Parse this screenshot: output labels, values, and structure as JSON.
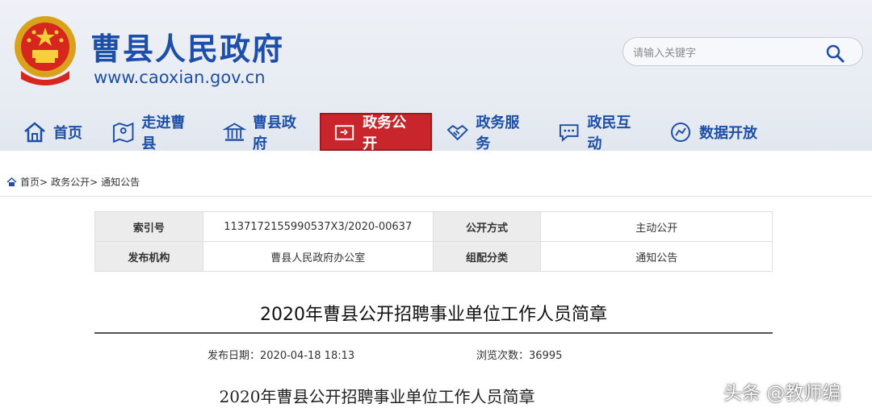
{
  "header": {
    "site_title": "曹县人民政府",
    "site_url": "www.caoxian.gov.cn",
    "search_placeholder": "请输入关键字"
  },
  "nav": [
    {
      "label": "首页",
      "icon": "home-icon"
    },
    {
      "label": "走进曹县",
      "icon": "map-icon"
    },
    {
      "label": "曹县政府",
      "icon": "government-building-icon"
    },
    {
      "label": "政务公开",
      "icon": "document-icon",
      "active": true
    },
    {
      "label": "政务服务",
      "icon": "handshake-icon"
    },
    {
      "label": "政民互动",
      "icon": "chat-icon"
    },
    {
      "label": "数据开放",
      "icon": "data-icon"
    }
  ],
  "breadcrumb": [
    "首页>",
    "政务公开>",
    "通知公告"
  ],
  "meta": {
    "index_label": "索引号",
    "index_value": "1137172155990537X3/2020-00637",
    "mode_label": "公开方式",
    "mode_value": "主动公开",
    "org_label": "发布机构",
    "org_value": "曹县人民政府办公室",
    "category_label": "组配分类",
    "category_value": "通知公告"
  },
  "article": {
    "title": "2020年曹县公开招聘事业单位工作人员简章",
    "publish": "发布日期：2020-04-18 18:13",
    "views": "浏览次数：36995",
    "body_title": "2020年曹县公开招聘事业单位工作人员简章"
  },
  "watermark": "头条 @教师编",
  "colors": {
    "brand_blue": "#1d4fa8",
    "active_red": "#c9252c"
  }
}
